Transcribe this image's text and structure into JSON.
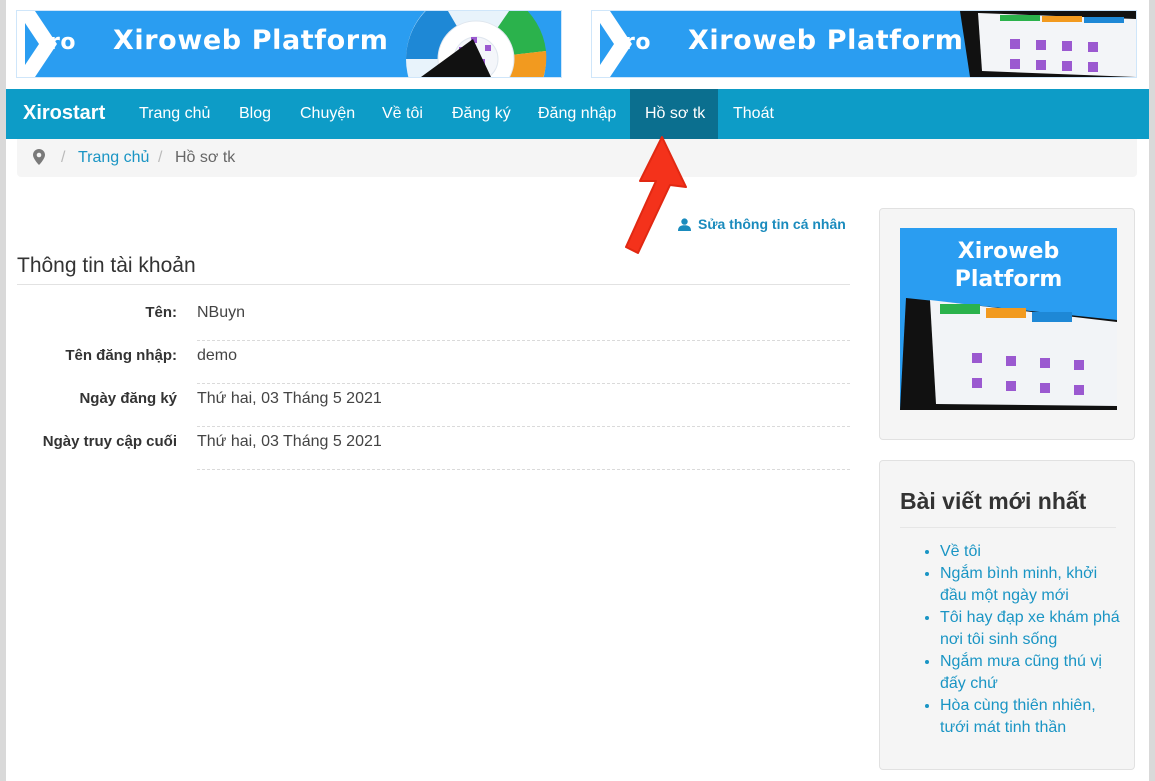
{
  "banners": [
    {
      "logo_text": "iro",
      "title": "Xiroweb Platform"
    },
    {
      "logo_text": "iro",
      "title": "Xiroweb Platform"
    }
  ],
  "navbar": {
    "brand": "Xirostart",
    "items": [
      "Trang chủ",
      "Blog",
      "Chuyện",
      "Về tôi",
      "Đăng ký",
      "Đăng nhập",
      "Hồ sơ tk",
      "Thoát"
    ],
    "active_index": 6,
    "color": "#0d9cc7",
    "active_color": "#0b6f8f"
  },
  "breadcrumb": {
    "separator": "/",
    "home": "Trang chủ",
    "current": "Hồ sơ tk"
  },
  "main": {
    "edit_link": "Sửa thông tin cá nhân",
    "section_title": "Thông tin tài khoản",
    "rows": [
      {
        "label": "Tên:",
        "value": "NBuyn"
      },
      {
        "label": "Tên đăng nhập:",
        "value": "demo"
      },
      {
        "label": "Ngày đăng ký",
        "value": "Thứ hai, 03 Tháng 5 2021"
      },
      {
        "label": "Ngày truy cập cuối",
        "value": "Thứ hai, 03 Tháng 5 2021"
      }
    ]
  },
  "sidebar": {
    "ad_title_line1": "Xiroweb",
    "ad_title_line2": "Platform",
    "posts_title": "Bài viết mới nhất",
    "posts": [
      "Về tôi",
      "Ngắm bình minh, khởi đầu một ngày mới",
      "Tôi hay đạp xe khám phá nơi tôi sinh sống",
      "Ngắm mưa cũng thú vị đấy chứ",
      "Hòa cùng thiên nhiên, tưới mát tinh thần"
    ]
  },
  "icons": {
    "breadcrumb": "map-marker-icon",
    "edit": "user-icon",
    "annotation": "red-arrow-icon"
  },
  "colors": {
    "brand_blue": "#2a9df1",
    "link": "#1a95c4",
    "arrow": "#f4321b"
  }
}
